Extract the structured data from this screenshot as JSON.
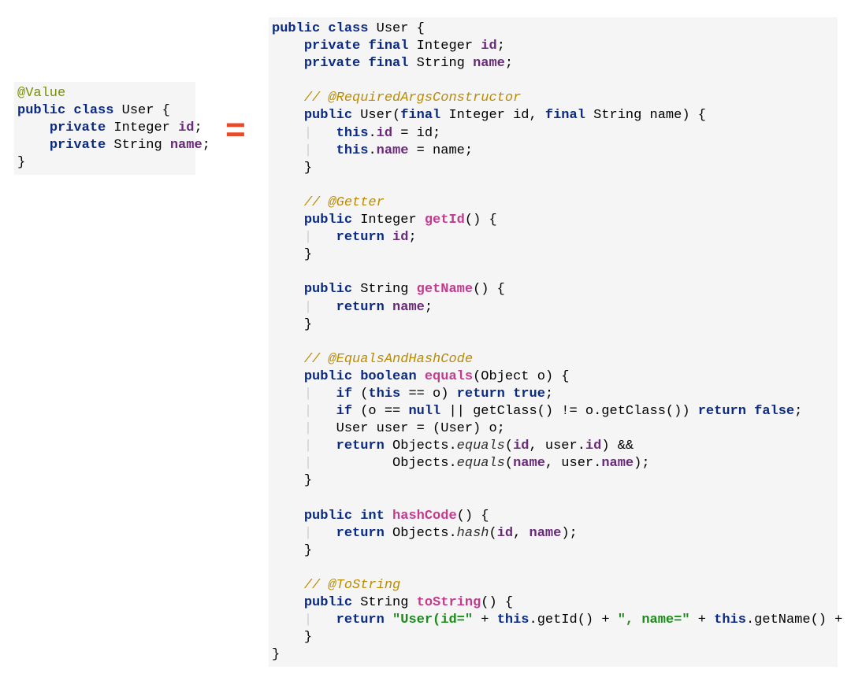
{
  "left": {
    "l1": "@Value",
    "l2_kw1": "public",
    "l2_kw2": "class",
    "l2_txt": " User {",
    "l3_kw": "private",
    "l3_type": " Integer ",
    "l3_fld": "id",
    "l3_end": ";",
    "l4_kw": "private",
    "l4_type": " String ",
    "l4_fld": "name",
    "l4_end": ";",
    "l5": "}"
  },
  "equals_symbol": "=",
  "right": {
    "r1_kw1": "public",
    "r1_kw2": "class",
    "r1_txt": " User {",
    "r2_kw1": "private",
    "r2_kw2": "final",
    "r2_type": " Integer ",
    "r2_fld": "id",
    "r2_end": ";",
    "r3_kw1": "private",
    "r3_kw2": "final",
    "r3_type": " String ",
    "r3_fld": "name",
    "r3_end": ";",
    "r5_cmt": "// @RequiredArgsConstructor",
    "r6_kw1": "public",
    "r6_name": " User(",
    "r6_kw2": "final",
    "r6_p1": " Integer id, ",
    "r6_kw3": "final",
    "r6_p2": " String name) {",
    "r7_kw": "this",
    "r7_dot": ".",
    "r7_fld": "id",
    "r7_rest": " = id;",
    "r8_kw": "this",
    "r8_dot": ".",
    "r8_fld": "name",
    "r8_rest": " = name;",
    "r11_cmt": "// @Getter",
    "r12_kw": "public",
    "r12_type": " Integer ",
    "r12_mth": "getId",
    "r12_rest": "() {",
    "r13_kw": "return",
    "r13_sp": " ",
    "r13_fld": "id",
    "r13_end": ";",
    "r15_kw": "public",
    "r15_type": " String ",
    "r15_mth": "getName",
    "r15_rest": "() {",
    "r16_kw": "return",
    "r16_sp": " ",
    "r16_fld": "name",
    "r16_end": ";",
    "r19_cmt": "// @EqualsAndHashCode",
    "r20_kw1": "public",
    "r20_kw2": "boolean",
    "r20_sp": " ",
    "r20_mth": "equals",
    "r20_rest": "(Object o) {",
    "r21_kw1": "if",
    "r21_a": " (",
    "r21_kw2": "this",
    "r21_b": " == o) ",
    "r21_kw3": "return true",
    "r21_c": ";",
    "r22_kw1": "if",
    "r22_a": " (o == ",
    "r22_kw2": "null",
    "r22_b": " || getClass() != o.getClass()) ",
    "r22_kw3": "return false",
    "r22_c": ";",
    "r23_txt": "User user = (User) o;",
    "r24_kw": "return",
    "r24_a": " Objects.",
    "r24_it": "equals",
    "r24_b": "(",
    "r24_fld1": "id",
    "r24_c": ", user.",
    "r24_fld2": "id",
    "r24_d": ") &&",
    "r25_a": "Objects.",
    "r25_it": "equals",
    "r25_b": "(",
    "r25_fld1": "name",
    "r25_c": ", user.",
    "r25_fld2": "name",
    "r25_d": ");",
    "r27_kw1": "public",
    "r27_kw2": "int",
    "r27_sp": " ",
    "r27_mth": "hashCode",
    "r27_rest": "() {",
    "r28_kw": "return",
    "r28_a": " Objects.",
    "r28_it": "hash",
    "r28_b": "(",
    "r28_fld1": "id",
    "r28_c": ", ",
    "r28_fld2": "name",
    "r28_d": ");",
    "r31_cmt": "// @ToString",
    "r32_kw": "public",
    "r32_type": " String ",
    "r32_mth": "toString",
    "r32_rest": "() {",
    "r33_kw1": "return",
    "r33_sp": " ",
    "r33_str1": "\"User(id=\"",
    "r33_a": " + ",
    "r33_kw2": "this",
    "r33_b": ".getId() + ",
    "r33_str2": "\", name=\"",
    "r33_c": " + ",
    "r33_kw3": "this",
    "r33_d": ".getName() + ",
    "r33_str3": "\")\"",
    "r33_e": ";",
    "brace_close": "}"
  }
}
